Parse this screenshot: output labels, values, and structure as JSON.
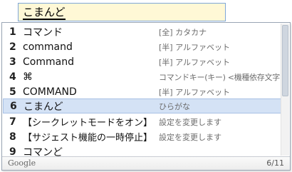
{
  "composition": {
    "text": "こまんど"
  },
  "candidates": [
    {
      "number": "1",
      "text": "コマンド",
      "description": "[全] カタカナ"
    },
    {
      "number": "2",
      "text": "command",
      "description": "[半] アルファベット"
    },
    {
      "number": "3",
      "text": "Command",
      "description": "[半] アルファベット"
    },
    {
      "number": "4",
      "text": "⌘",
      "description": "コマンドキー(キー) <機種依存文字>"
    },
    {
      "number": "5",
      "text": "COMMAND",
      "description": "[半] アルファベット"
    },
    {
      "number": "6",
      "text": "こまんど",
      "description": "ひらがな",
      "selected": true
    },
    {
      "number": "7",
      "text": "【シークレットモードをオン】",
      "description": "設定を変更します"
    },
    {
      "number": "8",
      "text": "【サジェスト機能の一時停止】",
      "description": "設定を変更します"
    },
    {
      "number": "9",
      "text": "コマンど",
      "description": ""
    }
  ],
  "footer": {
    "brand": "Google",
    "page": "6/11"
  },
  "colors": {
    "selection": "#d4e2f5",
    "composition_bg": "#fff8d6"
  }
}
